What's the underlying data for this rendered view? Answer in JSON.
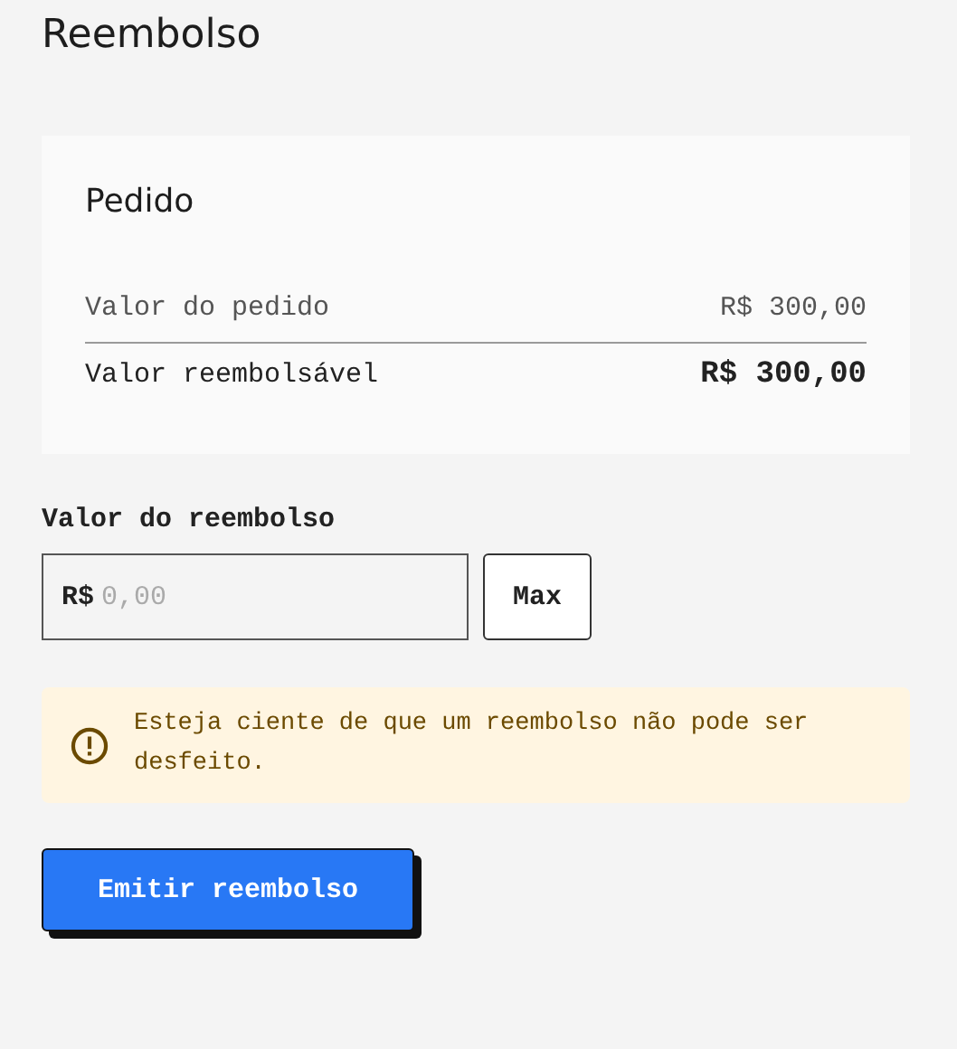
{
  "page": {
    "title": "Reembolso"
  },
  "order_card": {
    "title": "Pedido",
    "rows": [
      {
        "kind": "item",
        "label": "Valor do pedido",
        "value": "R$ 300,00"
      },
      {
        "kind": "total",
        "label": "Valor reembolsável",
        "value": "R$ 300,00"
      }
    ]
  },
  "refund_amount": {
    "label": "Valor do reembolso",
    "prefix": "R$",
    "placeholder": "0,00",
    "max_button": "Max"
  },
  "warning": {
    "text": "Esteja ciente de que um reembolso não pode ser desfeito."
  },
  "submit_button": "Emitir reembolso"
}
